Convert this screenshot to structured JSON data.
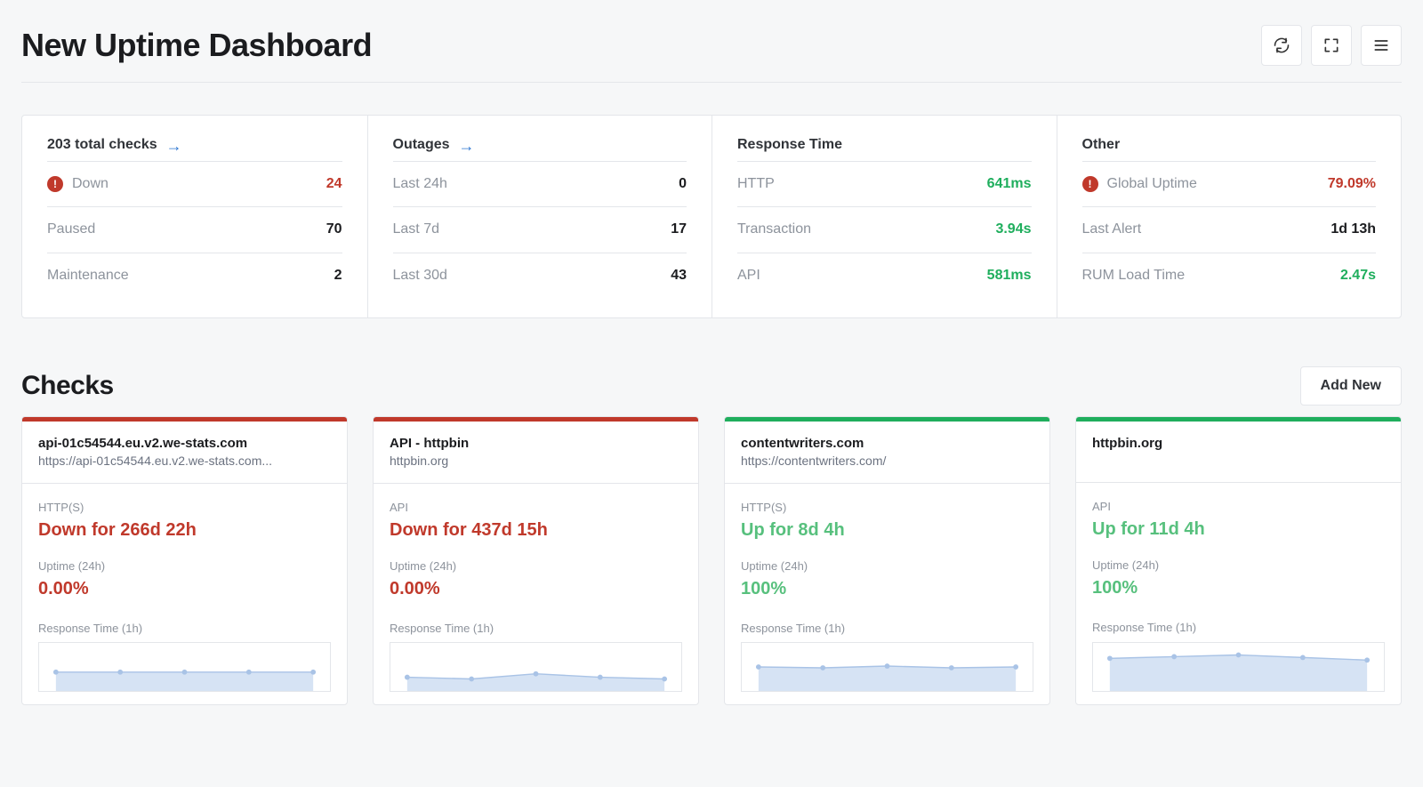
{
  "header": {
    "title": "New Uptime Dashboard",
    "add_new_label": "Add New",
    "checks_heading": "Checks"
  },
  "summary": [
    {
      "title": "203 total checks",
      "has_arrow": true,
      "rows": [
        {
          "label": "Down",
          "value": "24",
          "warn": true,
          "value_class": "red"
        },
        {
          "label": "Paused",
          "value": "70"
        },
        {
          "label": "Maintenance",
          "value": "2"
        }
      ]
    },
    {
      "title": "Outages",
      "has_arrow": true,
      "rows": [
        {
          "label": "Last 24h",
          "value": "0"
        },
        {
          "label": "Last 7d",
          "value": "17"
        },
        {
          "label": "Last 30d",
          "value": "43"
        }
      ]
    },
    {
      "title": "Response Time",
      "has_arrow": false,
      "rows": [
        {
          "label": "HTTP",
          "value": "641ms",
          "value_class": "green"
        },
        {
          "label": "Transaction",
          "value": "3.94s",
          "value_class": "green"
        },
        {
          "label": "API",
          "value": "581ms",
          "value_class": "green"
        }
      ]
    },
    {
      "title": "Other",
      "has_arrow": false,
      "rows": [
        {
          "label": "Global Uptime",
          "value": "79.09%",
          "warn": true,
          "value_class": "red"
        },
        {
          "label": "Last Alert",
          "value": "1d 13h"
        },
        {
          "label": "RUM Load Time",
          "value": "2.47s",
          "value_class": "green"
        }
      ]
    }
  ],
  "checks": [
    {
      "title": "api-01c54544.eu.v2.we-stats.com",
      "subtitle": "https://api-01c54544.eu.v2.we-stats.com...",
      "state": "down",
      "protocol": "HTTP(S)",
      "status": "Down for 266d 22h",
      "uptime_label": "Uptime (24h)",
      "uptime_value": "0.00%",
      "rt_label": "Response Time (1h)",
      "spark": [
        34,
        34,
        34,
        34,
        34
      ]
    },
    {
      "title": "API - httpbin",
      "subtitle": "httpbin.org",
      "state": "down",
      "protocol": "API",
      "status": "Down for 437d 15h",
      "uptime_label": "Uptime (24h)",
      "uptime_value": "0.00%",
      "rt_label": "Response Time (1h)",
      "spark": [
        40,
        42,
        36,
        40,
        42
      ]
    },
    {
      "title": "contentwriters.com",
      "subtitle": "https://contentwriters.com/",
      "state": "up",
      "protocol": "HTTP(S)",
      "status": "Up for 8d 4h",
      "uptime_label": "Uptime (24h)",
      "uptime_value": "100%",
      "rt_label": "Response Time (1h)",
      "spark": [
        28,
        29,
        27,
        29,
        28
      ]
    },
    {
      "title": "httpbin.org",
      "subtitle": "",
      "state": "up",
      "protocol": "API",
      "status": "Up for 11d 4h",
      "uptime_label": "Uptime (24h)",
      "uptime_value": "100%",
      "rt_label": "Response Time (1h)",
      "spark": [
        18,
        16,
        14,
        17,
        20
      ]
    }
  ]
}
